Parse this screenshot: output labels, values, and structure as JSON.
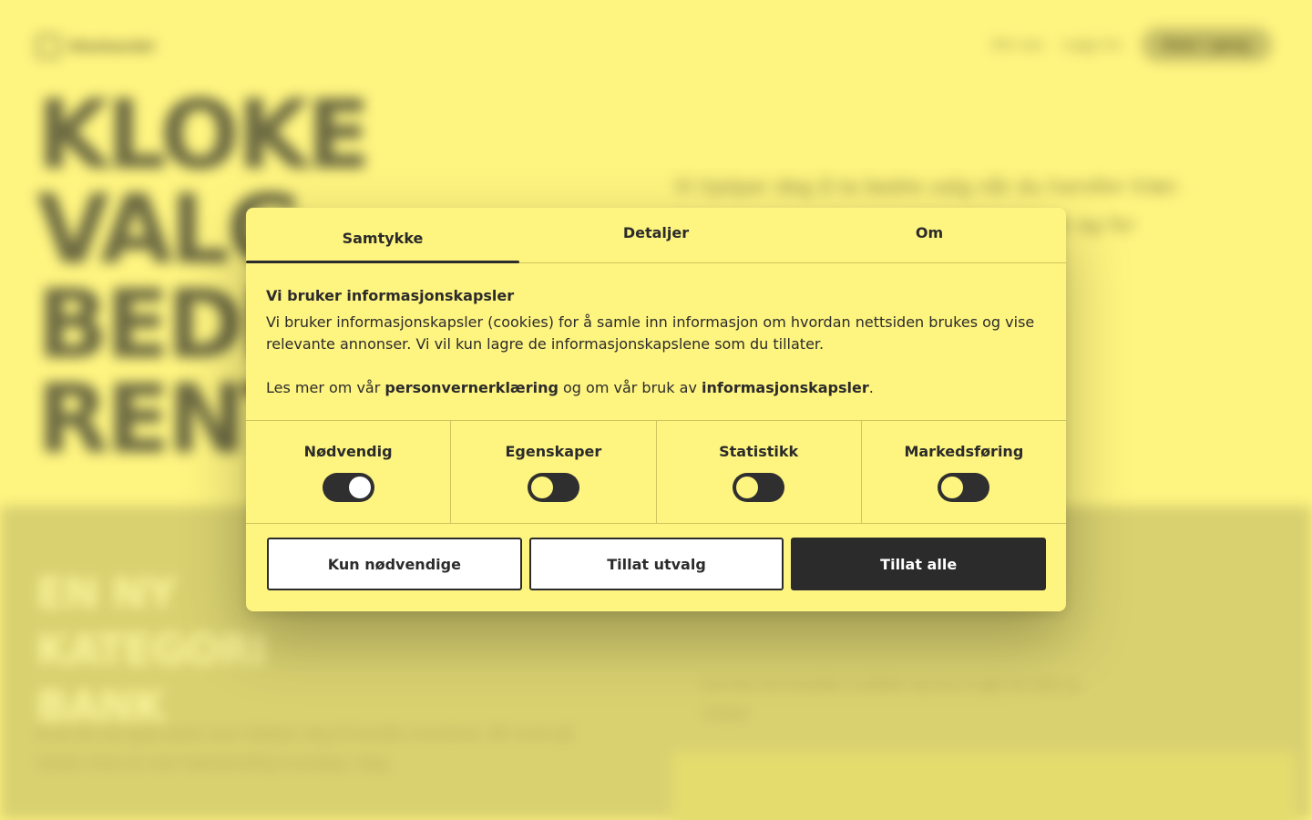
{
  "background": {
    "logo_text": "Kleshandel",
    "nav": {
      "items": [
        "Om oss",
        "Logg inn"
      ],
      "button": "Kom i gang"
    },
    "hero_lines": [
      "KLOKE",
      "VALG",
      "BEDRE",
      "RENT"
    ],
    "lede": "Vi hjelper deg å ta bedre valg når du handler klær. Gode valg er viktige for deg, for miljøet og for fremtiden.",
    "section_heading_lines": [
      "EN NY",
      "KATEGORI",
      "BANK"
    ],
    "section_text": "Vi er en ny type bank som hjelper deg å handle smartere. Bli med på reisen mot en mer bærekraftig hverdag i dag.",
    "side_text": "Les mer om hvordan vi jobber og hva vi gjør for deg og miljøet."
  },
  "dialog": {
    "tabs": [
      {
        "label": "Samtykke",
        "active": true
      },
      {
        "label": "Detaljer",
        "active": false
      },
      {
        "label": "Om",
        "active": false
      }
    ],
    "title": "Vi bruker informasjonskapsler",
    "text": "Vi bruker informasjonskapsler (cookies) for å samle inn informasjon om hvordan nettsiden brukes og vise relevante annonser. Vi vil kun lagre de informasjonskapslene som du tillater.",
    "more_prefix": "Les mer om vår ",
    "more_link1": "personvernerklæring",
    "more_middle": " og om vår bruk av ",
    "more_link2": "informasjonskapsler",
    "more_suffix": ".",
    "toggles": [
      {
        "label": "Nødvendig",
        "on": true
      },
      {
        "label": "Egenskaper",
        "on": false
      },
      {
        "label": "Statistikk",
        "on": false
      },
      {
        "label": "Markedsføring",
        "on": false
      }
    ],
    "buttons": {
      "necessary": "Kun nødvendige",
      "selection": "Tillat utvalg",
      "all": "Tillat alle"
    }
  },
  "colors": {
    "page_bg": "#fef480",
    "lower_bg": "#d9d170",
    "text": "#2b2b2b",
    "divider": "#cfc55f"
  }
}
